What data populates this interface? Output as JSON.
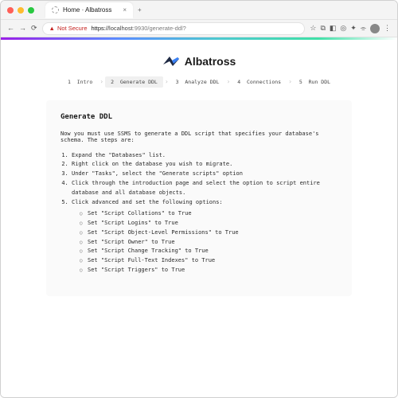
{
  "window": {
    "tab_title": "Home · Albatross",
    "url_scheme": "https",
    "url_host": "localhost",
    "url_port_path": ":9930/generate-ddl?",
    "not_secure_label": "Not Secure"
  },
  "brand": {
    "name": "Albatross"
  },
  "wizard": {
    "steps": [
      {
        "num": "1",
        "label": "Intro"
      },
      {
        "num": "2",
        "label": "Generate DDL"
      },
      {
        "num": "3",
        "label": "Analyze DDL"
      },
      {
        "num": "4",
        "label": "Connections"
      },
      {
        "num": "5",
        "label": "Run DDL"
      }
    ],
    "active_index": 1
  },
  "page": {
    "heading": "Generate DDL",
    "intro": "Now you must use SSMS to generate a DDL script that specifies your database's schema. The steps are:",
    "ordered": [
      "Expand the \"Databases\" list.",
      "Right click on the database you wish to migrate.",
      "Under \"Tasks\", select the \"Generate scripts\" option",
      "Click through the introduction page and select the option to script entire database and all database objects.",
      "Click advanced and set the following options:"
    ],
    "sub": [
      "Set \"Script Collations\" to True",
      "Set \"Script Logins\" to True",
      "Set \"Script Object-Level Permissions\" to True",
      "Set \"Script Owner\" to True",
      "Set \"Script Change Tracking\" to True",
      "Set \"Script Full-Text Indexes\" to True",
      "Set \"Script Triggers\" to True"
    ]
  }
}
